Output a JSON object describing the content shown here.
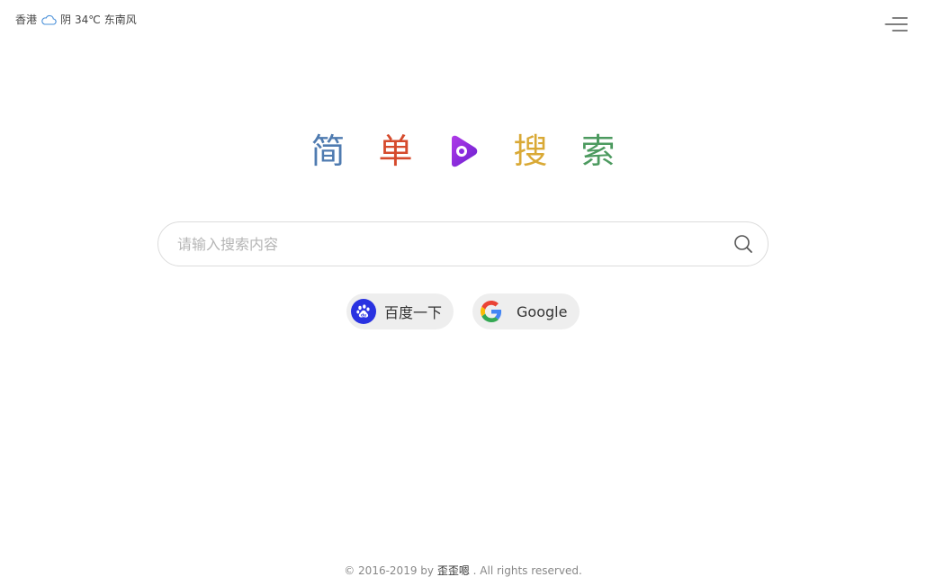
{
  "weather": {
    "city": "香港",
    "icon": "cloud-icon",
    "condition": "阴",
    "temperature": "34℃",
    "wind": "东南风"
  },
  "menu": {
    "icon": "menu-icon"
  },
  "logo": {
    "chars": [
      "简",
      "单",
      "搜",
      "索"
    ],
    "mark_icon": "brand-play-icon",
    "colors": [
      "#4f7bb0",
      "#d54a2c",
      "#8a2be2",
      "#d9a935",
      "#4c9a5f"
    ]
  },
  "search": {
    "placeholder": "请输入搜索内容",
    "value": "",
    "button_icon": "search-icon"
  },
  "engines": [
    {
      "label": "百度一下",
      "icon": "baidu-paw-icon",
      "color": "#2932e1"
    },
    {
      "label": "Google",
      "icon": "google-g-icon"
    }
  ],
  "footer": {
    "prefix": "© 2016-2019 by ",
    "author": "歪歪嗯",
    "suffix": " . All rights reserved."
  }
}
